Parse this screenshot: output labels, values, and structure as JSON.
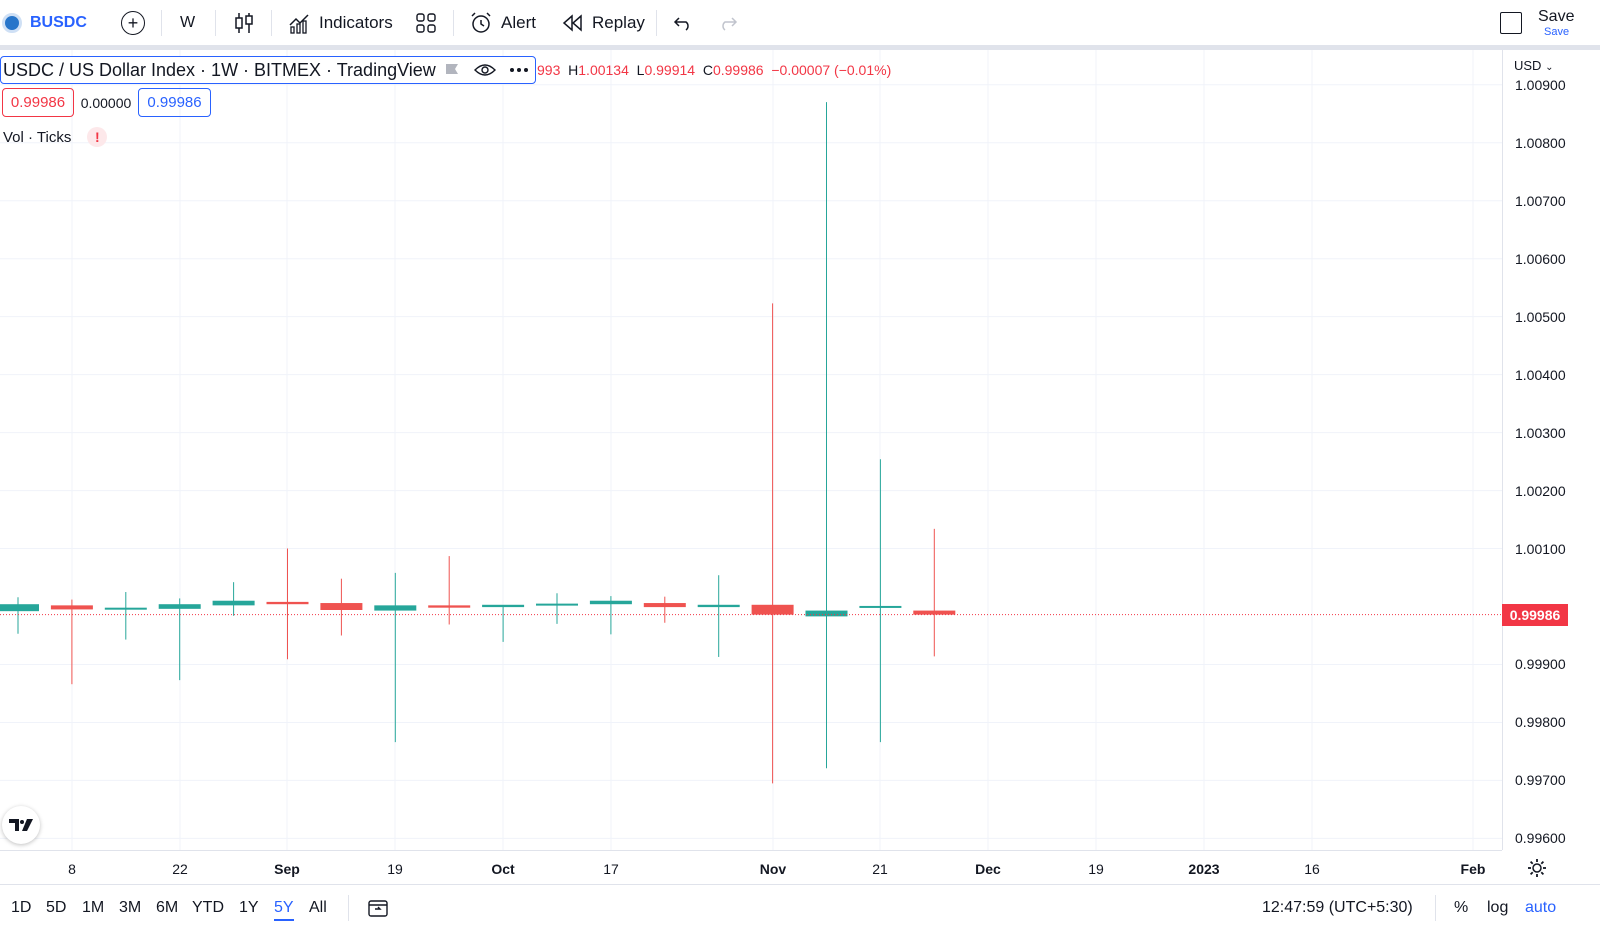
{
  "toolbar": {
    "symbol": "BUSDC",
    "interval": "W",
    "indicators_label": "Indicators",
    "alert_label": "Alert",
    "replay_label": "Replay",
    "save_label": "Save",
    "save_sub": "Save"
  },
  "legend": {
    "title": "USDC / US Dollar Index · 1W · BITMEX · TradingView",
    "ohlc_partial_open": "993",
    "high_key": "H",
    "high": "1.00134",
    "low_key": "L",
    "low": "0.99914",
    "close_key": "C",
    "close": "0.99986",
    "change": "−0.00007 (−0.01%)",
    "bid": "0.99986",
    "spread": "0.00000",
    "ask": "0.99986",
    "vol_label": "Vol · Ticks",
    "warning": "!"
  },
  "price_axis": {
    "currency": "USD",
    "ticks": [
      "1.00900",
      "1.00800",
      "1.00700",
      "1.00600",
      "1.00500",
      "1.00400",
      "1.00300",
      "1.00200",
      "1.00100",
      "0.99900",
      "0.99800",
      "0.99700",
      "0.99600"
    ],
    "last_price": "0.99986"
  },
  "time_axis": {
    "ticks": [
      "8",
      "22",
      "Sep",
      "19",
      "Oct",
      "17",
      "Nov",
      "21",
      "Dec",
      "19",
      "2023",
      "16",
      "Feb"
    ]
  },
  "bottom_bar": {
    "ranges": [
      "1D",
      "5D",
      "1M",
      "3M",
      "6M",
      "YTD",
      "1Y",
      "5Y",
      "All"
    ],
    "active_range": "5Y",
    "clock": "12:47:59 (UTC+5:30)",
    "percent": "%",
    "log": "log",
    "auto": "auto"
  },
  "colors": {
    "up": "#26a69a",
    "down": "#ef5350",
    "accent": "#2962ff"
  },
  "chart_data": {
    "type": "candlestick",
    "title": "USDC / US Dollar Index · 1W · BITMEX · TradingView",
    "ylim": [
      0.9958,
      1.0096
    ],
    "y_ticks": [
      1.009,
      1.008,
      1.007,
      1.006,
      1.005,
      1.004,
      1.003,
      1.002,
      1.001,
      0.999,
      0.998,
      0.997,
      0.996
    ],
    "candles": [
      {
        "o": 0.99992,
        "h": 1.00016,
        "l": 0.99953,
        "c": 1.00004
      },
      {
        "o": 1.00002,
        "h": 1.00012,
        "l": 0.99866,
        "c": 0.99995
      },
      {
        "o": 0.99997,
        "h": 1.00025,
        "l": 0.99943,
        "c": 0.99998
      },
      {
        "o": 0.99996,
        "h": 1.00014,
        "l": 0.99873,
        "c": 1.00004
      },
      {
        "o": 1.00002,
        "h": 1.00042,
        "l": 0.99984,
        "c": 1.0001
      },
      {
        "o": 1.00008,
        "h": 1.001,
        "l": 0.99909,
        "c": 1.00004
      },
      {
        "o": 1.00006,
        "h": 1.00048,
        "l": 0.9995,
        "c": 0.99994
      },
      {
        "o": 0.99993,
        "h": 1.00058,
        "l": 0.99766,
        "c": 1.00002
      },
      {
        "o": 1.00002,
        "h": 1.00087,
        "l": 0.99969,
        "c": 0.99998
      },
      {
        "o": 0.99999,
        "h": 1.00002,
        "l": 0.99939,
        "c": 1.00003
      },
      {
        "o": 1.00002,
        "h": 1.00023,
        "l": 0.9997,
        "c": 1.00005
      },
      {
        "o": 1.00004,
        "h": 1.00018,
        "l": 0.99952,
        "c": 1.0001
      },
      {
        "o": 1.00006,
        "h": 1.00017,
        "l": 0.99972,
        "c": 0.99999
      },
      {
        "o": 0.99999,
        "h": 1.00054,
        "l": 0.99913,
        "c": 1.00003
      },
      {
        "o": 1.00003,
        "h": 1.00523,
        "l": 0.99695,
        "c": 0.99986
      },
      {
        "o": 0.99983,
        "h": 1.0087,
        "l": 0.99721,
        "c": 0.99993
      },
      {
        "o": 0.99999,
        "h": 1.00254,
        "l": 0.99766,
        "c": 1.00001
      },
      {
        "o": 0.99993,
        "h": 1.00134,
        "l": 0.99914,
        "c": 0.99986
      }
    ],
    "last_price": 0.99986
  }
}
